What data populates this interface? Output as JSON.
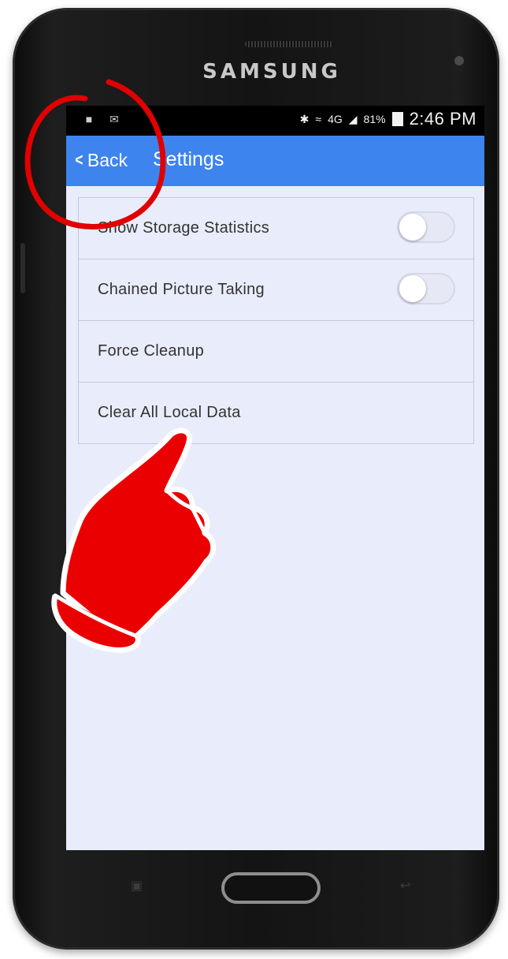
{
  "device": {
    "brand": "SAMSUNG"
  },
  "status_bar": {
    "network": "4G",
    "battery_percent": "81%",
    "time": "2:46 PM",
    "icons": [
      "nfl-icon",
      "email-icon",
      "bluetooth-icon",
      "wifi-icon",
      "signal-icon",
      "battery-icon"
    ]
  },
  "app_bar": {
    "back_label": "Back",
    "title": "Settings",
    "color": "#3e84ee"
  },
  "settings": {
    "items": [
      {
        "label": "Show Storage Statistics",
        "has_toggle": true,
        "toggle_on": false
      },
      {
        "label": "Chained Picture Taking",
        "has_toggle": true,
        "toggle_on": false
      },
      {
        "label": "Force Cleanup",
        "has_toggle": false
      },
      {
        "label": "Clear All Local Data",
        "has_toggle": false
      }
    ]
  },
  "annotations": {
    "highlight_color": "#e00000",
    "items": [
      "highlight-circle-annotation",
      "pointing-hand-annotation"
    ]
  }
}
